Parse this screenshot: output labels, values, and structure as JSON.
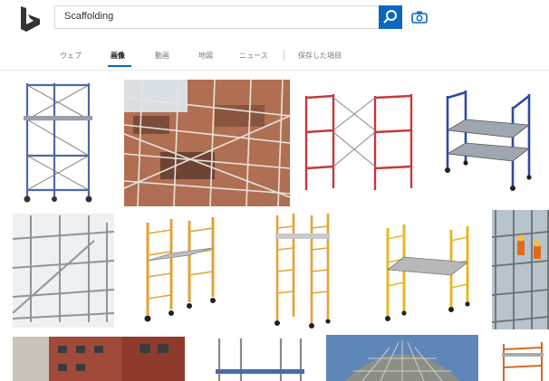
{
  "search": {
    "query": "Scaffolding"
  },
  "tabs": [
    {
      "label": "ウェブ"
    },
    {
      "label": "画像",
      "active": true
    },
    {
      "label": "動画"
    },
    {
      "label": "地図"
    },
    {
      "label": "ニュース"
    },
    {
      "label": "保存した項目"
    }
  ],
  "colors": {
    "accent": "#0c67c1",
    "logo": "#333333"
  },
  "icons": {
    "search": "search-icon",
    "camera": "camera-icon",
    "logo": "bing-logo"
  }
}
